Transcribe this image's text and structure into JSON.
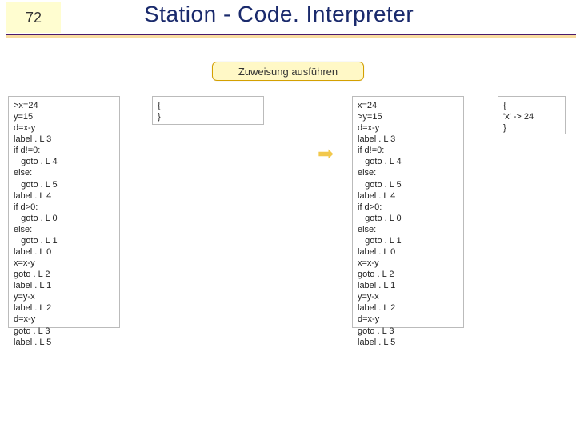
{
  "header": {
    "slide_number": "72",
    "title": "Station - Code. Interpreter"
  },
  "bubble": {
    "label": "Zuweisung ausführen"
  },
  "code_left": ">x=24\ny=15\nd=x-y\nlabel . L 3\nif d!=0:\n   goto . L 4\nelse:\n   goto . L 5\nlabel . L 4\nif d>0:\n   goto . L 0\nelse:\n   goto . L 1\nlabel . L 0\nx=x-y\ngoto . L 2\nlabel . L 1\ny=y-x\nlabel . L 2\nd=x-y\ngoto . L 3\nlabel . L 5",
  "code_mid": "{\n}",
  "code_right": "x=24\n>y=15\nd=x-y\nlabel . L 3\nif d!=0:\n   goto . L 4\nelse:\n   goto . L 5\nlabel . L 4\nif d>0:\n   goto . L 0\nelse:\n   goto . L 1\nlabel . L 0\nx=x-y\ngoto . L 2\nlabel . L 1\ny=y-x\nlabel . L 2\nd=x-y\ngoto . L 3\nlabel . L 5",
  "code_env": "{\n'x' -> 24\n}",
  "arrow_glyph": "➡"
}
